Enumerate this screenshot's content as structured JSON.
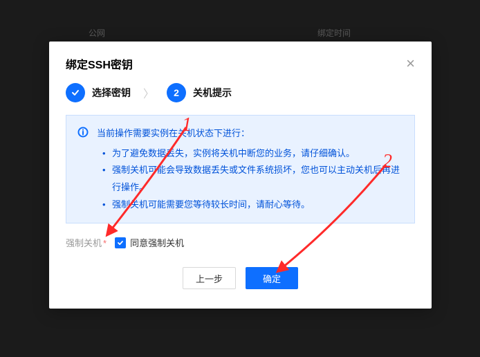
{
  "header": {
    "title": "绑定SSH密钥",
    "close": "×",
    "bgCol1": "公网",
    "bgCol2": "绑定时间"
  },
  "steps": {
    "s1Label": "选择密钥",
    "sep": "〉",
    "s2Num": "2",
    "s2Label": "关机提示"
  },
  "notice": {
    "title": "当前操作需要实例在关机状态下进行：",
    "i1": "为了避免数据丢失，实例将关机中断您的业务，请仔细确认。",
    "i2": "强制关机可能会导致数据丢失或文件系统损坏，您也可以主动关机后再进行操作。",
    "i3": "强制关机可能需要您等待较长时间，请耐心等待。"
  },
  "force": {
    "label": "强制关机",
    "star": "*",
    "cbText": "同意强制关机"
  },
  "buttons": {
    "prev": "上一步",
    "ok": "确定"
  },
  "anno": {
    "n1": "1",
    "n2": "2"
  }
}
